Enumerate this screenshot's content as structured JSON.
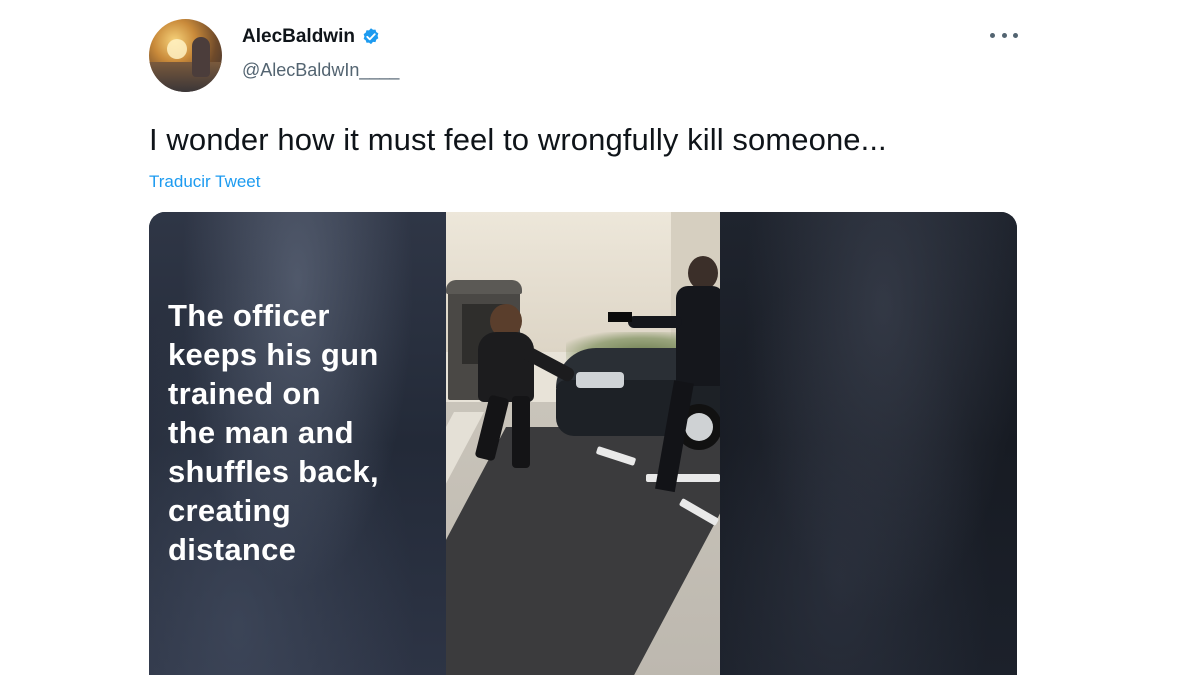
{
  "author": {
    "display_name": "AlecBaldwin",
    "handle": "@AlecBaldwIn____",
    "verified_color": "#1d9bf0"
  },
  "tweet": {
    "text": "I wonder how it must feel to wrongfully kill someone...",
    "translate_label": "Traducir Tweet"
  },
  "media": {
    "caption_lines": [
      "The officer",
      "keeps his gun",
      "trained on",
      "the man and",
      "shuffles back,",
      "creating",
      "distance"
    ]
  },
  "icons": {
    "more": "more-horizontal-icon",
    "verified": "verified-badge-icon"
  },
  "colors": {
    "text_primary": "#0f1419",
    "text_secondary": "#536471",
    "link": "#1d9bf0"
  }
}
